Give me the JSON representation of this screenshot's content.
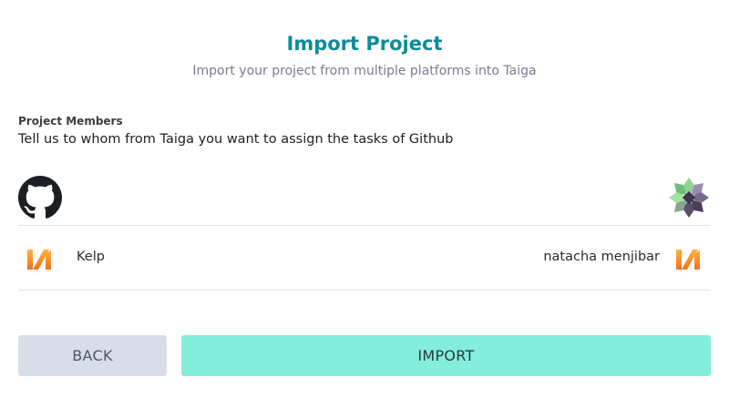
{
  "header": {
    "title": "Import Project",
    "subtitle": "Import your project from multiple platforms into Taiga"
  },
  "members_section": {
    "label": "Project Members",
    "description": "Tell us to whom from Taiga you want to assign the tasks of Github",
    "source_icon": "github-icon",
    "target_icon": "taiga-icon"
  },
  "members": [
    {
      "source_name": "Kelp",
      "assigned_to": "natacha menjibar",
      "avatar_colors": [
        "#f5a623",
        "#f26d1f"
      ]
    }
  ],
  "actions": {
    "back_label": "BACK",
    "import_label": "IMPORT"
  },
  "colors": {
    "title": "#0e8a9c",
    "import_button": "#83eede",
    "back_button": "#d8dee9"
  }
}
